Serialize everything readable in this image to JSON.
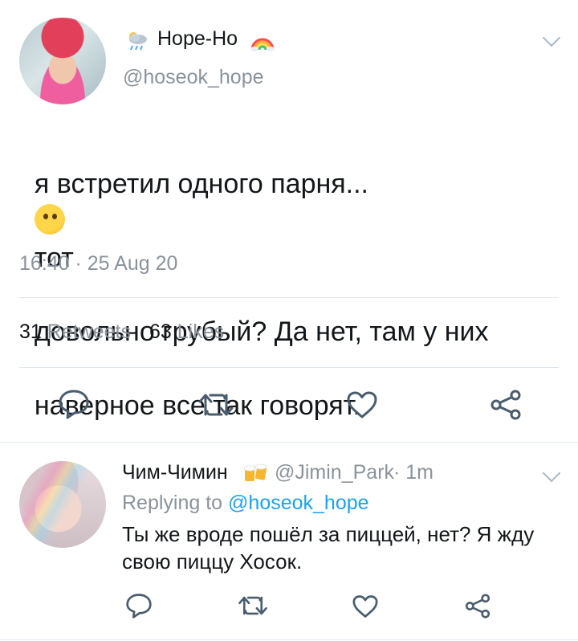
{
  "tweet": {
    "author_name": "Hope-Ho",
    "author_emoji_left": "weather-cloud-rain-icon",
    "author_emoji_right": "rainbow-icon",
    "handle": "@hoseok_hope",
    "text_line1": "я встретил одного парня...",
    "text_line1b": "тот",
    "text_line2": "довольно грубый? Да нет, там у них",
    "text_line3": "наверное все так говорят.",
    "timestamp": "16:40 · 25 Aug 20",
    "retweets_count": "31",
    "retweets_label": "Retweets",
    "likes_count": "63",
    "likes_label": "Likes"
  },
  "reply": {
    "author_name": "Чим-Чимин",
    "author_emoji": "beer-mugs-icon",
    "handle": "@Jimin_Park",
    "age": "· 1m",
    "replying_prefix": "Replying to",
    "replying_to": "@hoseok_hope",
    "text_line1": "Ты же вроде пошёл за пиццей, нет? Я жду",
    "text_line2": "свою пиццу Хосок."
  },
  "colors": {
    "text": "#14171a",
    "secondary": "#8a939b",
    "link": "#1da1f2",
    "icon": "#4a5d6e",
    "divider": "#e1e8ed"
  }
}
